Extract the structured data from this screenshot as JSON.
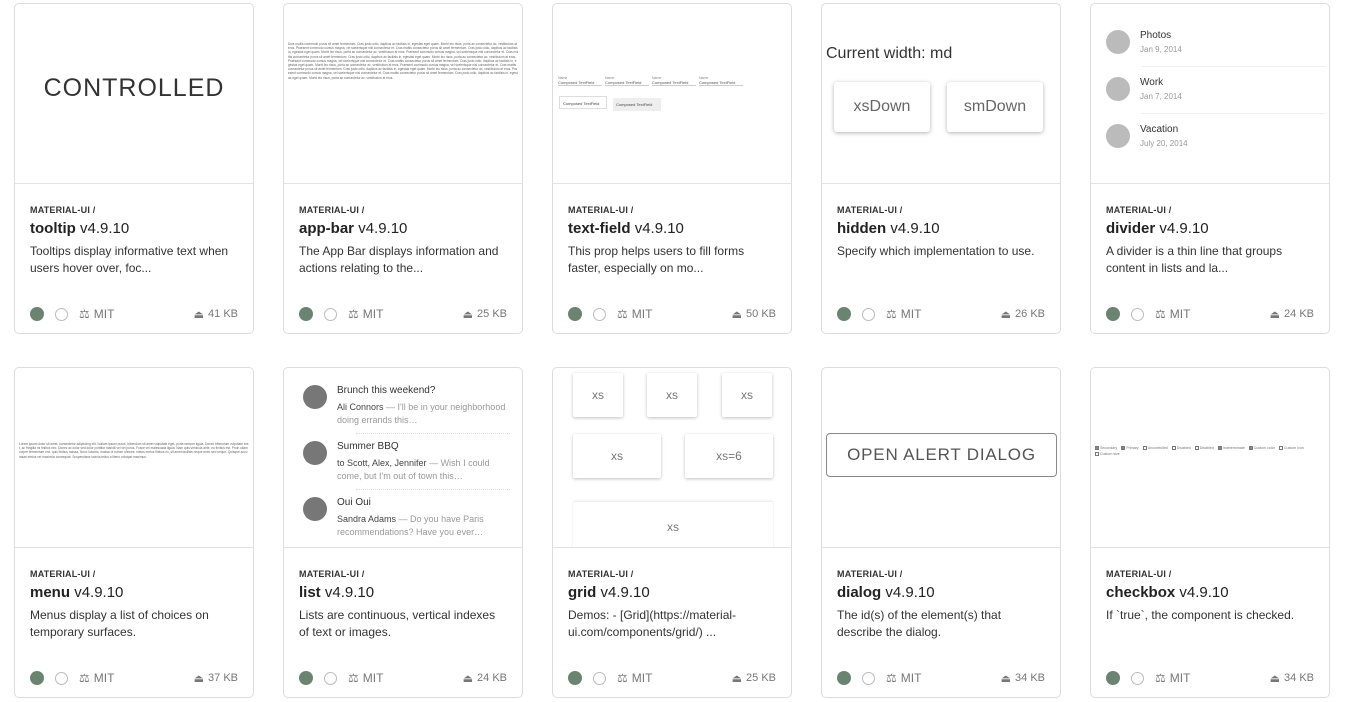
{
  "scope": "MATERIAL-UI /",
  "license": "MIT",
  "cards": [
    {
      "name": "tooltip",
      "version": "v4.9.10",
      "desc": "Tooltips display informative text when users hover over, foc...",
      "size": "41 KB",
      "preview": {
        "text": "CONTROLLED"
      }
    },
    {
      "name": "app-bar",
      "version": "v4.9.10",
      "desc": "The App Bar displays information and actions relating to the...",
      "size": "25 KB",
      "preview": {
        "text": "Duis mollis commodo purus sit amet fermentum. Cras justo odio, dapibus ac facilisis in, egestas eget quam. Morbi leo risus, porta ac consectetur ac, vestibulum at eros. Praesent commodo cursus magna, vel scelerisque nisl consectetur et. Cras mattis consectetur purus sit amet fermentum. Cras justo odio, dapibus ac facilisis in, egestas eget quam. Morbi leo risus, porta ac consectetur ac, vestibulum at eros. Praesent commodo cursus magna, vel scelerisque nisl consectetur et. Cras mattis consectetur purus sit amet fermentum. Cras justo odio, dapibus ac facilisis in, egestas eget quam. Morbi leo risus, porta ac consectetur ac, vestibulum at eros. Praesent commodo cursus magna, vel scelerisque nisl consectetur et. Cras mattis consectetur purus sit amet fermentum. Cras justo odio, dapibus ac facilisis in, egestas eget quam. Morbi leo risus, porta ac consectetur ac, vestibulum at eros. Praesent commodo cursus magna, vel scelerisque nisl consectetur et. Cras mattis consectetur purus sit amet fermentum. Cras justo odio, dapibus ac facilisis in, egestas eget quam. Morbi leo risus, porta ac consectetur ac, vestibulum at eros. Praesent commodo cursus magna, vel scelerisque nisl consectetur et. Cras mattis consectetur purus sit amet fermentum. Cras justo odio, dapibus ac facilisis in, egestas eget quam. Morbi leo risus, porta ac consectetur ac, vestibulum at eros."
      }
    },
    {
      "name": "text-field",
      "version": "v4.9.10",
      "desc": "This prop helps users to fill forms faster, especially on mo...",
      "size": "50 KB",
      "preview": {
        "field": "Composed TextField",
        "label": "Name"
      }
    },
    {
      "name": "hidden",
      "version": "v4.9.10",
      "desc": "Specify which implementation to use.",
      "size": "26 KB",
      "preview": {
        "heading": "Current width: md",
        "btn1": "xsDown",
        "btn2": "smDown"
      }
    },
    {
      "name": "divider",
      "version": "v4.9.10",
      "desc": "A divider is a thin line that groups content in lists and la...",
      "size": "24 KB",
      "preview": {
        "items": [
          {
            "t": "Photos",
            "d": "Jan 9, 2014"
          },
          {
            "t": "Work",
            "d": "Jan 7, 2014"
          },
          {
            "t": "Vacation",
            "d": "July 20, 2014"
          }
        ]
      }
    },
    {
      "name": "menu",
      "version": "v4.9.10",
      "desc": "Menus display a list of choices on temporary surfaces.",
      "size": "37 KB",
      "preview": {
        "text": "Lorem ipsum dolor sit amet, consectetur adipiscing elit. Nullam ipsum purus, bibendum sit amet vulputate eget, porta semper ligula. Donec bibendum vulputate erat, ac fringilla mi finibus nec. Donec ac dolor sed dolor porttitor blandit vel vel purus. Fusce vel malesuada ligula. Nam quis vehicula ante, eu finibus est. Proin ullamcorper fermentum orci, quis finibus massa. Nunc lobortis, massa ut rutrum ultrices, metus metus finibus ex, sit amet facilisis neque enim sed neque. Quisque accumsan metus vel maximus consequat. Suspendisse lacinia tellus a libero volutpat maximus."
      }
    },
    {
      "name": "list",
      "version": "v4.9.10",
      "desc": "Lists are continuous, vertical indexes of text or images.",
      "size": "24 KB",
      "preview": {
        "items": [
          {
            "t": "Brunch this weekend?",
            "who": "Ali Connors",
            "msg": " — I'll be in your neighborhood doing errands this…"
          },
          {
            "t": "Summer BBQ",
            "who": "to Scott, Alex, Jennifer",
            "msg": " — Wish I could come, but I'm out of town this…"
          },
          {
            "t": "Oui Oui",
            "who": "Sandra Adams",
            "msg": " — Do you have Paris recommendations? Have you ever…"
          }
        ]
      }
    },
    {
      "name": "grid",
      "version": "v4.9.10",
      "desc": "Demos: - [Grid](https://material-ui.com/components/grid/) ...",
      "size": "25 KB",
      "preview": {
        "xs": "xs",
        "xs6": "xs=6"
      }
    },
    {
      "name": "dialog",
      "version": "v4.9.10",
      "desc": "The id(s) of the element(s) that describe the dialog.",
      "size": "34 KB",
      "preview": {
        "button": "OPEN ALERT DIALOG"
      }
    },
    {
      "name": "checkbox",
      "version": "v4.9.10",
      "desc": "If `true`, the component is checked.",
      "size": "34 KB",
      "preview": {
        "labels": [
          "Secondary",
          "Primary",
          "Uncontrolled",
          "Disabled",
          "Disabled",
          "Indeterminate",
          "Custom color",
          "Custom icon",
          "Custom size"
        ]
      }
    }
  ]
}
